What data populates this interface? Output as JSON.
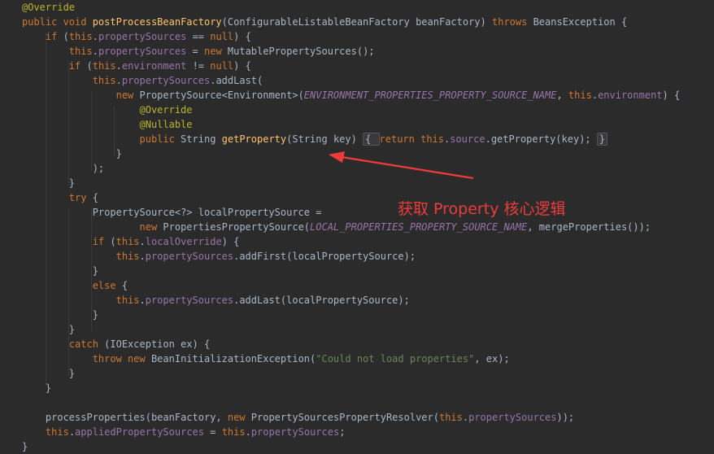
{
  "editor": {
    "lines": [
      [
        {
          "t": "ann",
          "v": "@Override"
        }
      ],
      [
        {
          "t": "kw",
          "v": "public void "
        },
        {
          "t": "fn",
          "v": "postProcessBeanFactory"
        },
        {
          "t": "pl",
          "v": "(ConfigurableListableBeanFactory beanFactory) "
        },
        {
          "t": "kw",
          "v": "throws "
        },
        {
          "t": "pl",
          "v": "BeansException {"
        }
      ],
      [
        {
          "t": "pl",
          "v": "    "
        },
        {
          "t": "kw",
          "v": "if "
        },
        {
          "t": "pl",
          "v": "("
        },
        {
          "t": "kw",
          "v": "this"
        },
        {
          "t": "pl",
          "v": "."
        },
        {
          "t": "fld",
          "v": "propertySources"
        },
        {
          "t": "pl",
          "v": " == "
        },
        {
          "t": "kw",
          "v": "null"
        },
        {
          "t": "pl",
          "v": ") {"
        }
      ],
      [
        {
          "t": "pl",
          "v": "        "
        },
        {
          "t": "kw",
          "v": "this"
        },
        {
          "t": "pl",
          "v": "."
        },
        {
          "t": "fld",
          "v": "propertySources"
        },
        {
          "t": "pl",
          "v": " = "
        },
        {
          "t": "kw",
          "v": "new "
        },
        {
          "t": "pl",
          "v": "MutablePropertySources();"
        }
      ],
      [
        {
          "t": "pl",
          "v": "        "
        },
        {
          "t": "kw",
          "v": "if "
        },
        {
          "t": "pl",
          "v": "("
        },
        {
          "t": "kw",
          "v": "this"
        },
        {
          "t": "pl",
          "v": "."
        },
        {
          "t": "fld",
          "v": "environment"
        },
        {
          "t": "pl",
          "v": " != "
        },
        {
          "t": "kw",
          "v": "null"
        },
        {
          "t": "pl",
          "v": ") {"
        }
      ],
      [
        {
          "t": "pl",
          "v": "            "
        },
        {
          "t": "kw",
          "v": "this"
        },
        {
          "t": "pl",
          "v": "."
        },
        {
          "t": "fld",
          "v": "propertySources"
        },
        {
          "t": "pl",
          "v": ".addLast("
        }
      ],
      [
        {
          "t": "pl",
          "v": "                "
        },
        {
          "t": "kw",
          "v": "new "
        },
        {
          "t": "pl",
          "v": "PropertySource<Environment>("
        },
        {
          "t": "const",
          "v": "ENVIRONMENT_PROPERTIES_PROPERTY_SOURCE_NAME"
        },
        {
          "t": "pl",
          "v": ", "
        },
        {
          "t": "kw",
          "v": "this"
        },
        {
          "t": "pl",
          "v": "."
        },
        {
          "t": "fld",
          "v": "environment"
        },
        {
          "t": "pl",
          "v": ") {"
        }
      ],
      [
        {
          "t": "pl",
          "v": "                    "
        },
        {
          "t": "ann",
          "v": "@Override"
        }
      ],
      [
        {
          "t": "pl",
          "v": "                    "
        },
        {
          "t": "ann",
          "v": "@Nullable"
        }
      ],
      [
        {
          "t": "pl",
          "v": "                    "
        },
        {
          "t": "kw",
          "v": "public "
        },
        {
          "t": "pl",
          "v": "String "
        },
        {
          "t": "fn",
          "v": "getProperty"
        },
        {
          "t": "pl",
          "v": "(String key) "
        },
        {
          "t": "fold",
          "v": "{ "
        },
        {
          "t": "kw",
          "v": "return this"
        },
        {
          "t": "pl",
          "v": "."
        },
        {
          "t": "fld",
          "v": "source"
        },
        {
          "t": "pl",
          "v": ".getProperty(key); "
        },
        {
          "t": "fold",
          "v": "}"
        }
      ],
      [
        {
          "t": "pl",
          "v": "                }"
        }
      ],
      [
        {
          "t": "pl",
          "v": "            );"
        }
      ],
      [
        {
          "t": "pl",
          "v": "        }"
        }
      ],
      [
        {
          "t": "pl",
          "v": "        "
        },
        {
          "t": "kw",
          "v": "try "
        },
        {
          "t": "pl",
          "v": "{"
        }
      ],
      [
        {
          "t": "pl",
          "v": "            PropertySource<?> localPropertySource ="
        }
      ],
      [
        {
          "t": "pl",
          "v": "                    "
        },
        {
          "t": "kw",
          "v": "new "
        },
        {
          "t": "pl",
          "v": "PropertiesPropertySource("
        },
        {
          "t": "const",
          "v": "LOCAL_PROPERTIES_PROPERTY_SOURCE_NAME"
        },
        {
          "t": "pl",
          "v": ", mergeProperties());"
        }
      ],
      [
        {
          "t": "pl",
          "v": "            "
        },
        {
          "t": "kw",
          "v": "if "
        },
        {
          "t": "pl",
          "v": "("
        },
        {
          "t": "kw",
          "v": "this"
        },
        {
          "t": "pl",
          "v": "."
        },
        {
          "t": "fld",
          "v": "localOverride"
        },
        {
          "t": "pl",
          "v": ") {"
        }
      ],
      [
        {
          "t": "pl",
          "v": "                "
        },
        {
          "t": "kw",
          "v": "this"
        },
        {
          "t": "pl",
          "v": "."
        },
        {
          "t": "fld",
          "v": "propertySources"
        },
        {
          "t": "pl",
          "v": ".addFirst(localPropertySource);"
        }
      ],
      [
        {
          "t": "pl",
          "v": "            }"
        }
      ],
      [
        {
          "t": "pl",
          "v": "            "
        },
        {
          "t": "kw",
          "v": "else "
        },
        {
          "t": "pl",
          "v": "{"
        }
      ],
      [
        {
          "t": "pl",
          "v": "                "
        },
        {
          "t": "kw",
          "v": "this"
        },
        {
          "t": "pl",
          "v": "."
        },
        {
          "t": "fld",
          "v": "propertySources"
        },
        {
          "t": "pl",
          "v": ".addLast(localPropertySource);"
        }
      ],
      [
        {
          "t": "pl",
          "v": "            }"
        }
      ],
      [
        {
          "t": "pl",
          "v": "        }"
        }
      ],
      [
        {
          "t": "pl",
          "v": "        "
        },
        {
          "t": "kw",
          "v": "catch "
        },
        {
          "t": "pl",
          "v": "(IOException ex) {"
        }
      ],
      [
        {
          "t": "pl",
          "v": "            "
        },
        {
          "t": "kw",
          "v": "throw new "
        },
        {
          "t": "pl",
          "v": "BeanInitializationException("
        },
        {
          "t": "str",
          "v": "\"Could not load properties\""
        },
        {
          "t": "pl",
          "v": ", ex);"
        }
      ],
      [
        {
          "t": "pl",
          "v": "        }"
        }
      ],
      [
        {
          "t": "pl",
          "v": "    }"
        }
      ],
      [],
      [
        {
          "t": "pl",
          "v": "    processProperties(beanFactory, "
        },
        {
          "t": "kw",
          "v": "new "
        },
        {
          "t": "pl",
          "v": "PropertySourcesPropertyResolver("
        },
        {
          "t": "kw",
          "v": "this"
        },
        {
          "t": "pl",
          "v": "."
        },
        {
          "t": "fld",
          "v": "propertySources"
        },
        {
          "t": "pl",
          "v": "));"
        }
      ],
      [
        {
          "t": "pl",
          "v": "    "
        },
        {
          "t": "kw",
          "v": "this"
        },
        {
          "t": "pl",
          "v": "."
        },
        {
          "t": "fld",
          "v": "appliedPropertySources"
        },
        {
          "t": "pl",
          "v": " = "
        },
        {
          "t": "kw",
          "v": "this"
        },
        {
          "t": "pl",
          "v": "."
        },
        {
          "t": "fld",
          "v": "propertySources"
        },
        {
          "t": "pl",
          "v": ";"
        }
      ],
      [
        {
          "t": "pl",
          "v": "}"
        }
      ]
    ]
  },
  "annotation": {
    "text": "获取 Property 核心逻辑",
    "color": "#ef3b3b"
  },
  "colors": {
    "background": "#2b2b2b",
    "keyword": "#cc7832",
    "annotation": "#bbb529",
    "method": "#ffc66d",
    "field": "#9876aa",
    "string": "#6a8759",
    "plain": "#a9b7c6"
  }
}
